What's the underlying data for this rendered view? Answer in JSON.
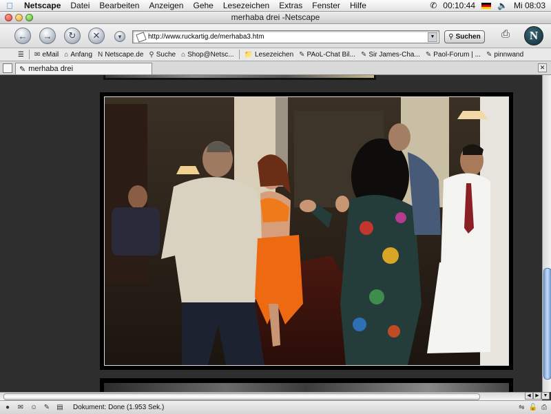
{
  "menubar": {
    "app_name": "Netscape",
    "items": [
      "Datei",
      "Bearbeiten",
      "Anzeigen",
      "Gehe",
      "Lesezeichen",
      "Extras",
      "Fenster",
      "Hilfe"
    ],
    "timer": "00:10:44",
    "clock": "Mi 08:03"
  },
  "window": {
    "title": "merhaba drei -Netscape"
  },
  "navbar": {
    "url": "http://www.ruckartig.de/merhaba3.htm",
    "search_label": "Suchen",
    "logo_letter": "N"
  },
  "personal_toolbar": {
    "items": [
      {
        "icon": "mail-icon",
        "label": "eMail"
      },
      {
        "icon": "home-icon",
        "label": "Anfang"
      },
      {
        "icon": "netscape-icon",
        "label": "Netscape.de"
      },
      {
        "icon": "search-icon",
        "label": "Suche"
      },
      {
        "icon": "shop-icon",
        "label": "Shop@Netsc..."
      },
      {
        "icon": "folder-icon",
        "label": "Lesezeichen"
      },
      {
        "icon": "bookmark-icon",
        "label": "PAoL-Chat Bil..."
      },
      {
        "icon": "bookmark-icon",
        "label": "Sir James-Cha..."
      },
      {
        "icon": "bookmark-icon",
        "label": "Paol-Forum | ..."
      },
      {
        "icon": "bookmark-icon",
        "label": "pinnwand"
      }
    ]
  },
  "tabs": [
    {
      "label": "merhaba drei"
    }
  ],
  "statusbar": {
    "text": "Dokument: Done (1.953 Sek.)"
  },
  "colors": {
    "page_background": "#2f2f2f",
    "photo_frame": "#000000",
    "scroll_thumb": "#7ea3d9"
  }
}
